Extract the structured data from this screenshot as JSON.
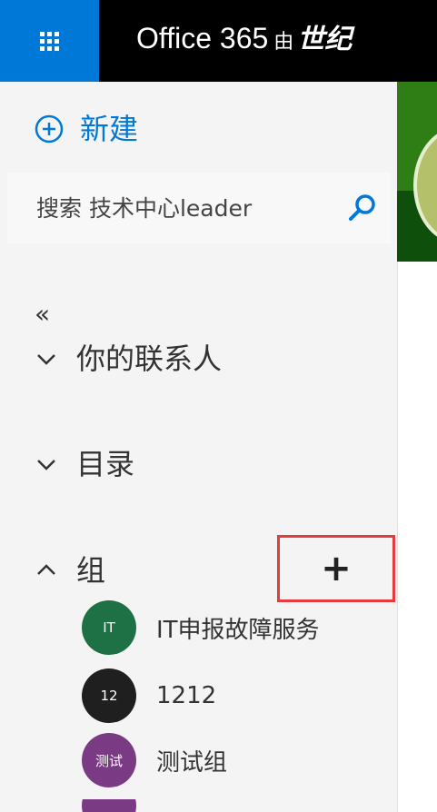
{
  "header": {
    "app_name": "Office 365",
    "by": "由",
    "org_partial": "世纪"
  },
  "new_button": {
    "label": "新建"
  },
  "search": {
    "placeholder": "搜索 技术中心leader"
  },
  "collapse": {
    "glyph": "«"
  },
  "sections": {
    "contacts": "你的联系人",
    "directory": "目录",
    "groups": "组"
  },
  "add_group": {
    "glyph": "+"
  },
  "groups": [
    {
      "initials": "IT",
      "name": "IT申报故障服务",
      "color": "#1e7145"
    },
    {
      "initials": "12",
      "name": "1212",
      "color": "#1f1f1f"
    },
    {
      "initials": "测试",
      "name": "测试组",
      "color": "#7b3b84"
    },
    {
      "initials": "",
      "name": "",
      "color": "#7b3b84"
    }
  ],
  "colors": {
    "accent": "#0078d7",
    "highlight_border": "#e8393d"
  }
}
